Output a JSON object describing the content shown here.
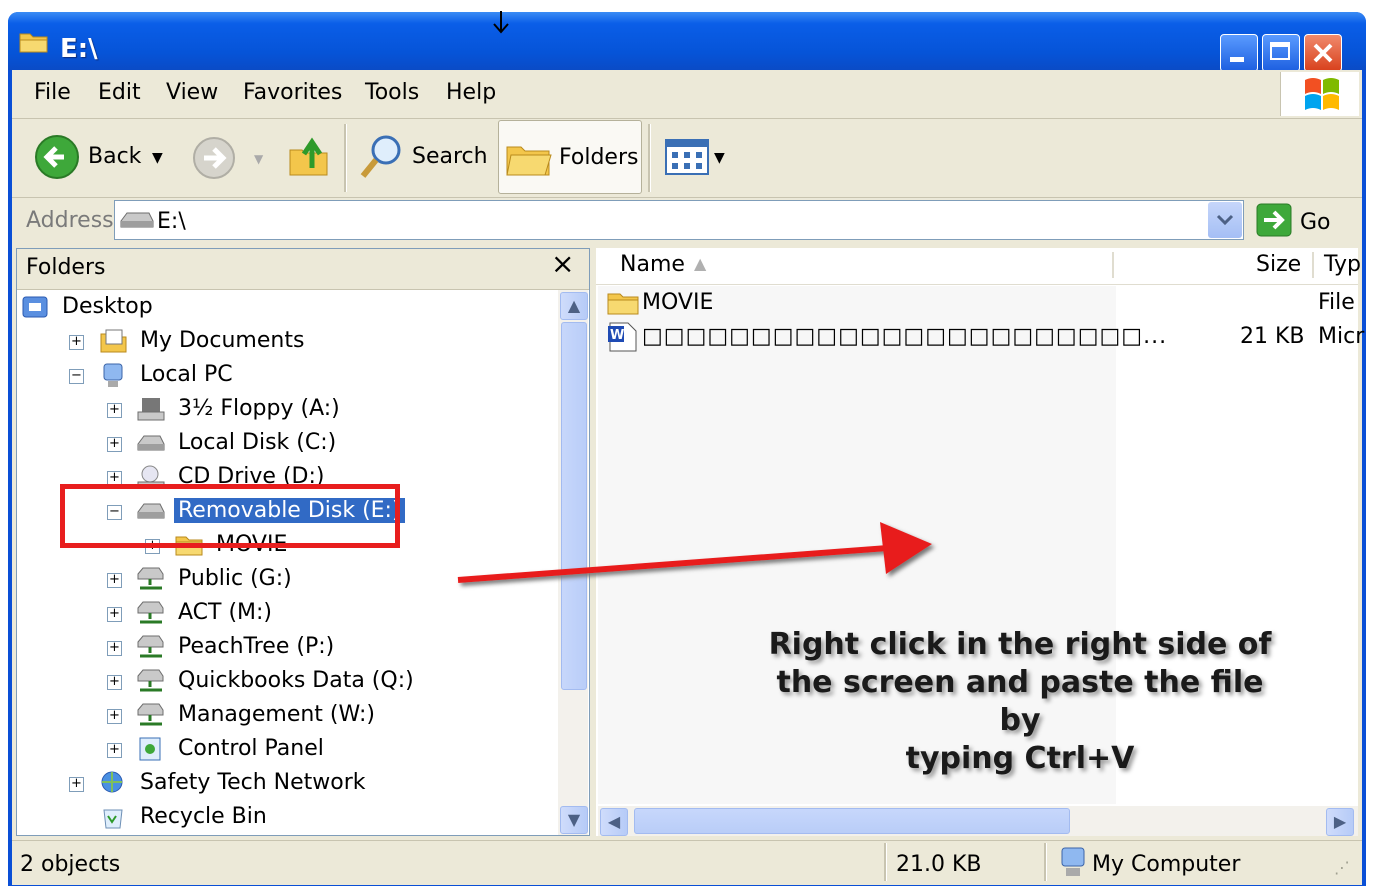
{
  "window": {
    "title": "E:\\"
  },
  "menu": [
    "File",
    "Edit",
    "View",
    "Favorites",
    "Tools",
    "Help"
  ],
  "toolbar": {
    "back_label": "Back",
    "search_label": "Search",
    "folders_label": "Folders"
  },
  "address": {
    "label": "Address",
    "value": "E:\\",
    "go_label": "Go"
  },
  "folders_pane": {
    "header": "Folders",
    "close": "×",
    "items": [
      {
        "label": "Desktop",
        "icon": "desktop-icon",
        "expander": ""
      },
      {
        "label": "My Documents",
        "icon": "my-documents-icon",
        "expander": "+"
      },
      {
        "label": "Local PC",
        "icon": "computer-icon",
        "expander": "−"
      },
      {
        "label": "3½ Floppy (A:)",
        "icon": "floppy-icon",
        "expander": "+"
      },
      {
        "label": "Local Disk (C:)",
        "icon": "disk-icon",
        "expander": "+"
      },
      {
        "label": "CD Drive (D:)",
        "icon": "cd-drive-icon",
        "expander": "+"
      },
      {
        "label": "Removable Disk (E:)",
        "icon": "removable-disk-icon",
        "expander": "−",
        "selected": true
      },
      {
        "label": "MOVIE",
        "icon": "folder-icon",
        "expander": "+"
      },
      {
        "label": "Public (G:)",
        "icon": "network-drive-icon",
        "expander": "+"
      },
      {
        "label": "ACT (M:)",
        "icon": "network-drive-icon",
        "expander": "+"
      },
      {
        "label": "PeachTree (P:)",
        "icon": "network-drive-icon",
        "expander": "+"
      },
      {
        "label": "Quickbooks Data (Q:)",
        "icon": "network-drive-icon",
        "expander": "+"
      },
      {
        "label": "Management (W:)",
        "icon": "network-drive-icon",
        "expander": "+"
      },
      {
        "label": "Control Panel",
        "icon": "control-panel-icon",
        "expander": "+"
      },
      {
        "label": "Safety Tech Network",
        "icon": "network-icon",
        "expander": "+"
      },
      {
        "label": "Recycle Bin",
        "icon": "recycle-bin-icon",
        "expander": ""
      }
    ]
  },
  "file_list": {
    "columns": [
      "Name",
      "Size",
      "Typ"
    ],
    "rows": [
      {
        "name": "MOVIE",
        "size": "",
        "type": "File",
        "icon": "folder-icon"
      },
      {
        "name": "□□□□□□□□□□□□□□□□□□□□□□□...",
        "size": "21 KB",
        "type": "Micr",
        "icon": "word-document-icon"
      }
    ]
  },
  "status": {
    "objects": "2 objects",
    "size": "21.0 KB",
    "location": "My Computer"
  },
  "annotation": {
    "line1": "Right click in the right side of",
    "line2": "the screen and paste the file by",
    "line3": "typing Ctrl+V",
    "color": "#e81e1e"
  }
}
